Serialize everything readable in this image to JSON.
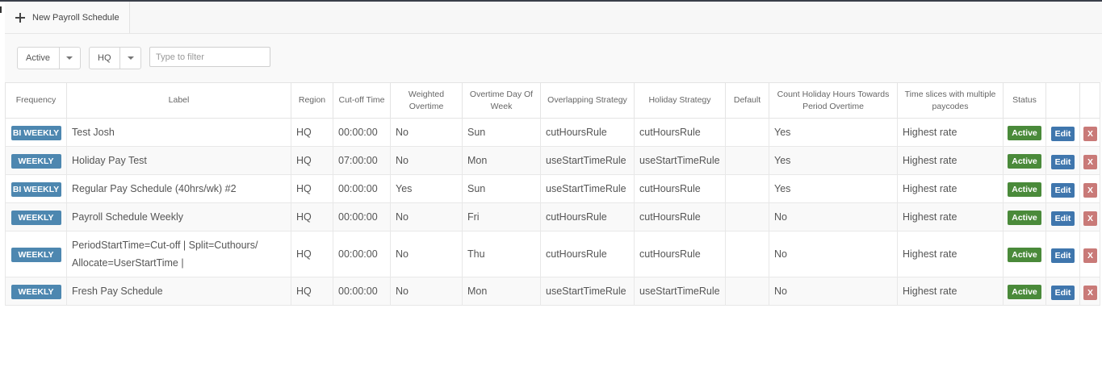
{
  "toolbar": {
    "new_button_label": "New Payroll Schedule"
  },
  "filters": {
    "status_value": "Active",
    "region_value": "HQ",
    "search_placeholder": "Type to filter"
  },
  "table": {
    "headers": {
      "frequency": "Frequency",
      "label": "Label",
      "region": "Region",
      "cutoff": "Cut-off Time",
      "weighted": "Weighted Overtime",
      "overtime_day": "Overtime Day Of Week",
      "overlapping": "Overlapping Strategy",
      "holiday": "Holiday Strategy",
      "default": "Default",
      "count_holiday": "Count Holiday Hours Towards Period Overtime",
      "time_slices": "Time slices with multiple paycodes",
      "status": "Status"
    },
    "rows": [
      {
        "frequency": "BI WEEKLY",
        "label": "Test Josh",
        "region": "HQ",
        "cutoff": "00:00:00",
        "weighted": "No",
        "overtime_day": "Sun",
        "overlapping": "cutHoursRule",
        "holiday": "cutHoursRule",
        "default": "",
        "count_holiday": "Yes",
        "time_slices": "Highest rate",
        "status": "Active",
        "edit": "Edit",
        "delete": "X"
      },
      {
        "frequency": "WEEKLY",
        "label": "Holiday Pay Test",
        "region": "HQ",
        "cutoff": "07:00:00",
        "weighted": "No",
        "overtime_day": "Mon",
        "overlapping": "useStartTimeRule",
        "holiday": "useStartTimeRule",
        "default": "",
        "count_holiday": "Yes",
        "time_slices": "Highest rate",
        "status": "Active",
        "edit": "Edit",
        "delete": "X"
      },
      {
        "frequency": "BI WEEKLY",
        "label": "Regular Pay Schedule (40hrs/wk) #2",
        "region": "HQ",
        "cutoff": "00:00:00",
        "weighted": "Yes",
        "overtime_day": "Sun",
        "overlapping": "useStartTimeRule",
        "holiday": "cutHoursRule",
        "default": "",
        "count_holiday": "Yes",
        "time_slices": "Highest rate",
        "status": "Active",
        "edit": "Edit",
        "delete": "X"
      },
      {
        "frequency": "WEEKLY",
        "label": "Payroll Schedule Weekly",
        "region": "HQ",
        "cutoff": "00:00:00",
        "weighted": "No",
        "overtime_day": "Fri",
        "overlapping": "cutHoursRule",
        "holiday": "cutHoursRule",
        "default": "",
        "count_holiday": "No",
        "time_slices": "Highest rate",
        "status": "Active",
        "edit": "Edit",
        "delete": "X"
      },
      {
        "frequency": "WEEKLY",
        "label": "PeriodStartTime=Cut-off | Split=Cuthours/ Allocate=UserStartTime |",
        "region": "HQ",
        "cutoff": "00:00:00",
        "weighted": "No",
        "overtime_day": "Thu",
        "overlapping": "cutHoursRule",
        "holiday": "cutHoursRule",
        "default": "",
        "count_holiday": "No",
        "time_slices": "Highest rate",
        "status": "Active",
        "edit": "Edit",
        "delete": "X"
      },
      {
        "frequency": "WEEKLY",
        "label": "Fresh Pay Schedule",
        "region": "HQ",
        "cutoff": "00:00:00",
        "weighted": "No",
        "overtime_day": "Mon",
        "overlapping": "useStartTimeRule",
        "holiday": "useStartTimeRule",
        "default": "",
        "count_holiday": "No",
        "time_slices": "Highest rate",
        "status": "Active",
        "edit": "Edit",
        "delete": "X"
      }
    ]
  }
}
